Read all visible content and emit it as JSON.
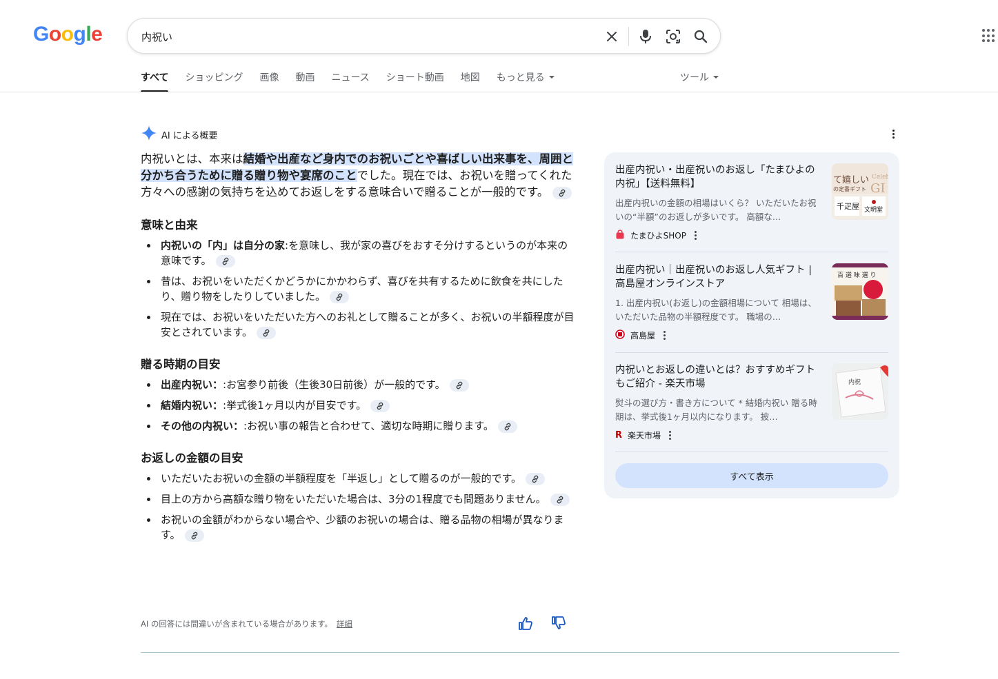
{
  "header": {
    "logo_letters": [
      "G",
      "o",
      "o",
      "g",
      "l",
      "e"
    ],
    "search_query": "内祝い"
  },
  "tabs": [
    {
      "label": "すべて",
      "active": true
    },
    {
      "label": "ショッピング"
    },
    {
      "label": "画像"
    },
    {
      "label": "動画"
    },
    {
      "label": "ニュース"
    },
    {
      "label": "ショート動画"
    },
    {
      "label": "地図"
    },
    {
      "label": "もっと見る"
    }
  ],
  "tools_label": "ツール",
  "ai": {
    "heading": "AI による概要",
    "intro_pre": "内祝いとは、本来は",
    "intro_highlight": "結婚や出産など身内でのお祝いごとや喜ばしい出来事を、周囲と分かち合うために贈る贈り物や宴席のこと",
    "intro_post": "でした。現在では、お祝いを贈ってくれた方々への感謝の気持ちを込めてお返しをする意味合いで贈ることが一般的です。",
    "sections": [
      {
        "title": "意味と由来",
        "items": [
          {
            "bold": "内祝いの「内」は自分の家",
            "text": ":を意味し、我が家の喜びをおすそ分けするというのが本来の意味です。"
          },
          {
            "bold": "",
            "text": "昔は、お祝いをいただくかどうかにかかわらず、喜びを共有するために飲食を共にしたり、贈り物をしたりしていました。"
          },
          {
            "bold": "",
            "text": "現在では、お祝いをいただいた方へのお礼として贈ることが多く、お祝いの半額程度が目安とされています。"
          }
        ]
      },
      {
        "title": "贈る時期の目安",
        "items": [
          {
            "bold": "出産内祝い：",
            "text": ":お宮参り前後（生後30日前後）が一般的です。"
          },
          {
            "bold": "結婚内祝い：",
            "text": ":挙式後1ヶ月以内が目安です。"
          },
          {
            "bold": "その他の内祝い：",
            "text": ":お祝い事の報告と合わせて、適切な時期に贈ります。"
          }
        ]
      },
      {
        "title": "お返しの金額の目安",
        "items": [
          {
            "bold": "",
            "text": "いただいたお祝いの金額の半額程度を「半返し」として贈るのが一般的です。"
          },
          {
            "bold": "",
            "text": "目上の方から高額な贈り物をいただいた場合は、3分の1程度でも問題ありません。"
          },
          {
            "bold": "",
            "text": "お祝いの金額がわからない場合や、少額のお祝いの場合は、贈る品物の相場が異なります。"
          }
        ]
      }
    ],
    "disclaimer": "AI の回答には間違いが含まれている場合があります。",
    "details_link": "詳細"
  },
  "sources": [
    {
      "title": "出産内祝い・出産祝いのお返し「たまひよの内祝」【送料無料】",
      "snippet": "出産内祝いの金額の相場はいくら？ いただいたお祝いの“半額”のお返しが多いです。 高額な…",
      "source": "たまひよSHOP",
      "img_text_1": "て嬉しい",
      "img_text_2": "の定番ギフト",
      "img_text_3": "Celeb",
      "img_text_4": "GI",
      "img_text_5": "千疋屋",
      "img_text_6": "文明堂",
      "favicon_color": "#e8384f"
    },
    {
      "title": "出産内祝い｜出産祝いのお返し人気ギフト | 高島屋オンラインストア",
      "snippet": "1. 出産内祝い(お返し)の金額相場について 相場は、いただいた品物の半額程度です。 職場の…",
      "source": "高島屋",
      "img_text_1": "百 選 味 選 り",
      "favicon_color": "#d0021b"
    },
    {
      "title": "内祝いとお返しの違いとは？おすすめギフトもご紹介 - 楽天市場",
      "snippet": "熨斗の選び方・書き方について * 結婚内祝い 贈る時期は、挙式後1ヶ月以内になります。 披…",
      "source": "楽天市場",
      "img_text_1": "内祝",
      "favicon_color": "#bf0000"
    }
  ],
  "show_all_label": "すべて表示"
}
